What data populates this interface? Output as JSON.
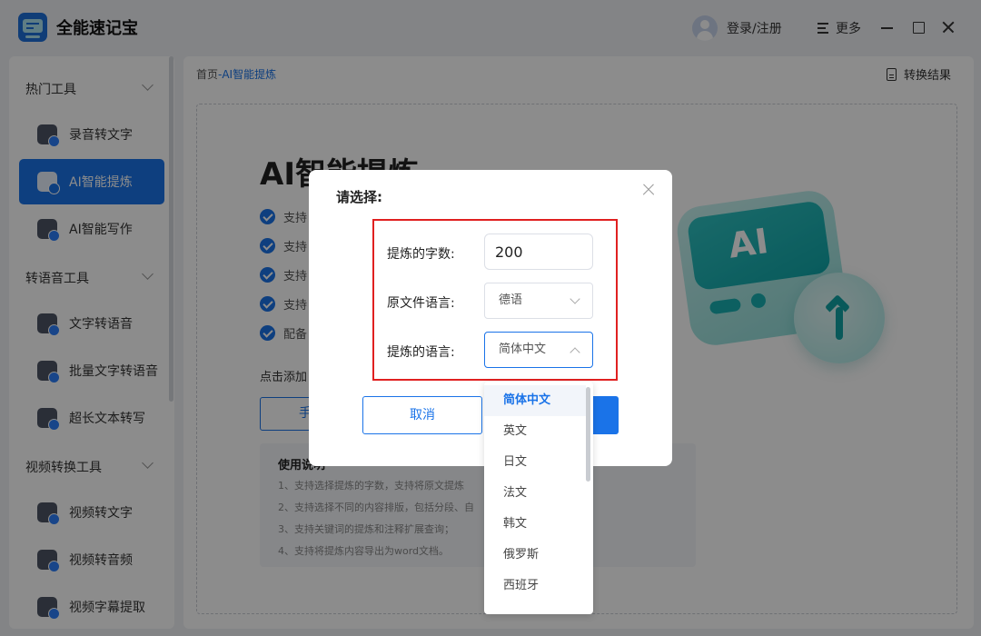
{
  "app": {
    "title": "全能速记宝"
  },
  "header": {
    "login_label": "登录/注册",
    "more_label": "更多"
  },
  "sidebar": {
    "groups": [
      {
        "label": "热门工具"
      },
      {
        "label": "转语音工具"
      },
      {
        "label": "视频转换工具"
      }
    ],
    "items": [
      {
        "label": "录音转文字"
      },
      {
        "label": "AI智能提炼"
      },
      {
        "label": "AI智能写作"
      },
      {
        "label": "文字转语音"
      },
      {
        "label": "批量文字转语音"
      },
      {
        "label": "超长文本转写"
      },
      {
        "label": "视频转文字"
      },
      {
        "label": "视频转音频"
      },
      {
        "label": "视频字幕提取"
      }
    ],
    "active_index": 1
  },
  "main": {
    "breadcrumb_home": "首页",
    "breadcrumb_current": "-AI智能提炼",
    "result_label": "转换结果",
    "heading": "AI智能提炼",
    "features": [
      "支持",
      "支持",
      "支持",
      "支持",
      "配备"
    ],
    "add_text": "点击添加",
    "upload_button": "手",
    "instructions": {
      "title": "使用说明",
      "lines": [
        "1、支持选择提炼的字数，支持将原文提炼",
        "2、支持选择不同的内容排版，包括分段、自",
        "3、支持关键词的提炼和注释扩展查询；",
        "4、支持将提炼内容导出为word文档。"
      ]
    },
    "illustration_text": "AI"
  },
  "modal": {
    "title": "请选择:",
    "word_count_label": "提炼的字数:",
    "word_count_value": "200",
    "source_lang_label": "原文件语言:",
    "source_lang_value": "德语",
    "target_lang_label": "提炼的语言:",
    "target_lang_value": "简体中文",
    "cancel_label": "取消",
    "dropdown_options": [
      "简体中文",
      "英文",
      "日文",
      "法文",
      "韩文",
      "俄罗斯",
      "西班牙"
    ],
    "selected_option_index": 0
  }
}
